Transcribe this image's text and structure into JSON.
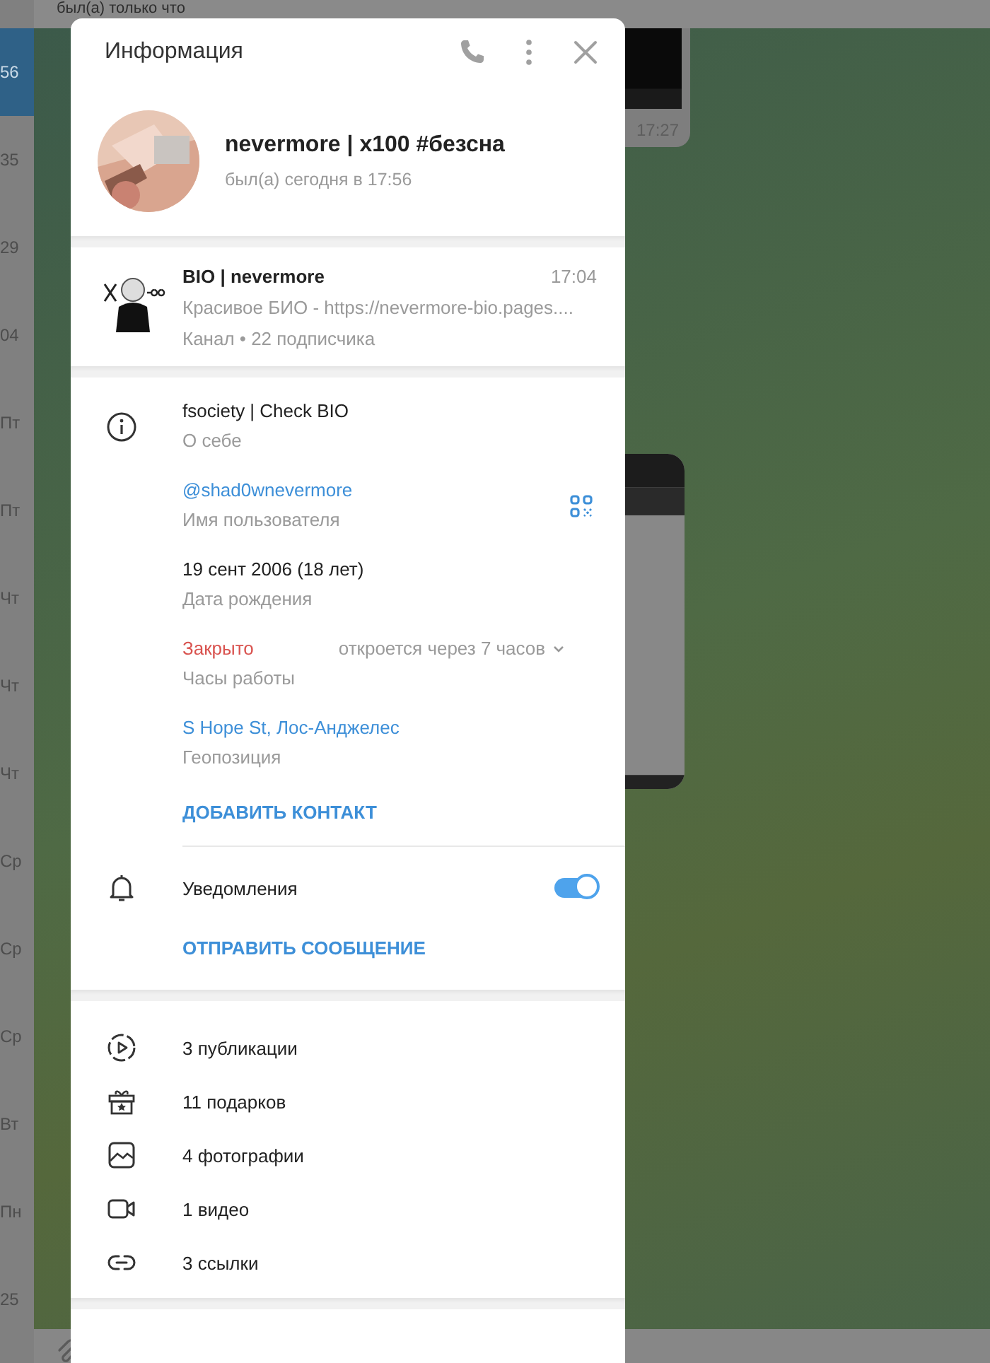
{
  "chat_header": {
    "status": "был(а) только что"
  },
  "chat_list": {
    "items": [
      {
        "time": "56",
        "selected": true
      },
      {
        "time": "35",
        "selected": false
      },
      {
        "time": "29",
        "selected": false
      },
      {
        "time": "04",
        "selected": false
      },
      {
        "time": "Пт",
        "selected": false
      },
      {
        "time": "Пт",
        "selected": false
      },
      {
        "time": "Чт",
        "selected": false
      },
      {
        "time": "Чт",
        "selected": false
      },
      {
        "time": "Чт",
        "selected": false
      },
      {
        "time": "Ср",
        "selected": false
      },
      {
        "time": "Ср",
        "selected": false
      },
      {
        "time": "Ср",
        "selected": false
      },
      {
        "time": "Вт",
        "selected": false
      },
      {
        "time": "Пн",
        "selected": false
      },
      {
        "time": "25",
        "selected": false
      }
    ]
  },
  "messages": [
    {
      "time": "17:27"
    },
    {
      "kind": "screenshot"
    }
  ],
  "dialog": {
    "title": "Информация",
    "profile": {
      "name": "nevermore | x100 #безсна",
      "status": "был(а) сегодня в 17:56"
    },
    "channel": {
      "name": "BIO | nevermore",
      "time": "17:04",
      "preview": "Красивое БИО - https://nevermore-bio.pages....",
      "meta": "Канал • 22 подписчика"
    },
    "info": [
      {
        "kind": "about",
        "value": "fsociety | Check BIO",
        "label": "О себе"
      },
      {
        "kind": "username",
        "value": "@shad0wnevermore",
        "label": "Имя пользователя"
      },
      {
        "kind": "birthday",
        "value": "19 сент 2006 (18 лет)",
        "label": "Дата рождения"
      },
      {
        "kind": "hours",
        "value": "Закрыто",
        "label": "Часы работы",
        "extra": "откроется через 7 часов"
      },
      {
        "kind": "location",
        "value": "S Hope St, Лос-Анджелес",
        "label": "Геопозиция"
      }
    ],
    "add_contact": "ДОБАВИТЬ КОНТАКТ",
    "notifications": {
      "label": "Уведомления",
      "on": true
    },
    "send_message": "ОТПРАВИТЬ СООБЩЕНИЕ",
    "media": [
      {
        "kind": "stories",
        "label": "3 публикации"
      },
      {
        "kind": "gifts",
        "label": "11 подарков"
      },
      {
        "kind": "photos",
        "label": "4 фотографии"
      },
      {
        "kind": "videos",
        "label": "1 видео"
      },
      {
        "kind": "links",
        "label": "3 ссылки"
      }
    ]
  }
}
